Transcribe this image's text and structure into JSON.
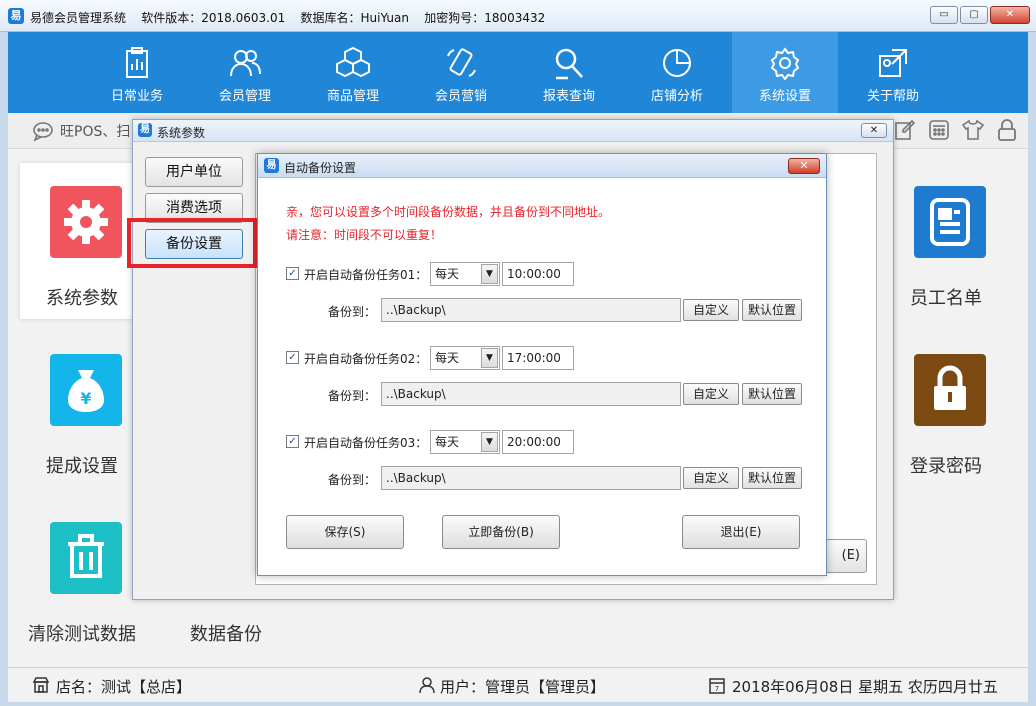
{
  "window": {
    "title": "易德会员管理系统    软件版本：2018.0603.01    数据库名：HuiYuan    加密狗号：18003432",
    "buttons": {
      "minimize": "▭",
      "maximize": "▢",
      "close": "✕"
    }
  },
  "nav": {
    "items": [
      {
        "label": "日常业务",
        "icon": "clipboard-icon"
      },
      {
        "label": "会员管理",
        "icon": "users-icon"
      },
      {
        "label": "商品管理",
        "icon": "cubes-icon"
      },
      {
        "label": "会员营销",
        "icon": "phone-icon"
      },
      {
        "label": "报表查询",
        "icon": "search-report-icon"
      },
      {
        "label": "店铺分析",
        "icon": "pie-chart-icon"
      },
      {
        "label": "系统设置",
        "icon": "gear-icon",
        "active": true
      },
      {
        "label": "关于帮助",
        "icon": "help-icon"
      }
    ]
  },
  "infostrip": {
    "marquee": "旺POS、扫"
  },
  "tiles": {
    "left": [
      {
        "label": "系统参数",
        "color": "#f0555d"
      },
      {
        "label": "提成设置",
        "color": "#14b5eb"
      },
      {
        "label": "清除测试数据",
        "color": "#1dbfc7"
      }
    ],
    "extra": {
      "label": "数据备份"
    },
    "right": [
      {
        "label": "员工名单",
        "color": "#1f7bd0"
      },
      {
        "label": "登录密码",
        "color": "#7a4a12"
      }
    ]
  },
  "statusbar": {
    "store": "店名：测试【总店】",
    "user": "用户：管理员【管理员】",
    "date": "2018年06月08日 星期五 农历四月廿五"
  },
  "dialog_params": {
    "title": "系统参数",
    "close": "✕",
    "side_buttons": [
      "用户单位",
      "消费选项",
      "备份设置"
    ],
    "selected": "备份设置",
    "exit_partial": "(E)"
  },
  "dialog_backup": {
    "title": "自动备份设置",
    "close": "✕",
    "notice1": "亲，您可以设置多个时间段备份数据，并且备份到不同地址。",
    "notice2": "请注意：时间段不可以重复！",
    "tasks": [
      {
        "label": "开启自动备份任务01：",
        "checked": true,
        "frequency": "每天",
        "time": "10:00:00",
        "path_label": "备份到：",
        "path": "..\\Backup\\"
      },
      {
        "label": "开启自动备份任务02：",
        "checked": true,
        "frequency": "每天",
        "time": "17:00:00",
        "path_label": "备份到：",
        "path": "..\\Backup\\"
      },
      {
        "label": "开启自动备份任务03：",
        "checked": true,
        "frequency": "每天",
        "time": "20:00:00",
        "path_label": "备份到：",
        "path": "..\\Backup\\"
      }
    ],
    "custom_btn": "自定义",
    "default_btn": "默认位置",
    "save_btn": "保存(S)",
    "backup_now_btn": "立即备份(B)",
    "exit_btn": "退出(E)"
  }
}
